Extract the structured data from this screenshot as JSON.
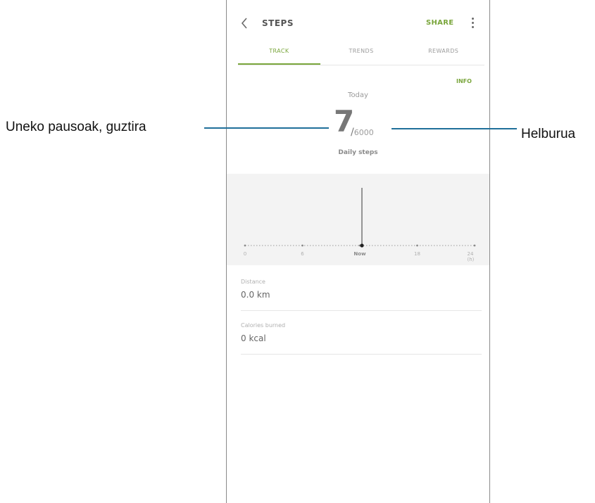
{
  "appbar": {
    "title": "STEPS",
    "share_label": "SHARE",
    "back_icon": "chevron-left-icon",
    "more_icon": "more-vertical-icon"
  },
  "tabs": [
    {
      "label": "TRACK",
      "active": true
    },
    {
      "label": "TRENDS",
      "active": false
    },
    {
      "label": "REWARDS",
      "active": false
    }
  ],
  "summary": {
    "info_label": "INFO",
    "date_label": "Today",
    "current_steps": "7",
    "goal_slash": "/",
    "goal_steps": "6000",
    "caption": "Daily steps"
  },
  "chart_data": {
    "type": "bar",
    "x_ticks": [
      "0",
      "6",
      "Now",
      "18",
      "24 (h)"
    ],
    "values": [
      {
        "x": 12,
        "steps": 7
      }
    ],
    "xlim": [
      0,
      24
    ]
  },
  "metrics": [
    {
      "label": "Distance",
      "value": "0.0 km"
    },
    {
      "label": "Calories burned",
      "value": "0 kcal"
    }
  ],
  "callouts": {
    "left": "Uneko pausoak, guztira",
    "right": "Helburua",
    "line_color": "#1f6f9a"
  },
  "colors": {
    "accent": "#7aa63c",
    "chart_background": "#f3f3f3",
    "bar": "#555555"
  }
}
